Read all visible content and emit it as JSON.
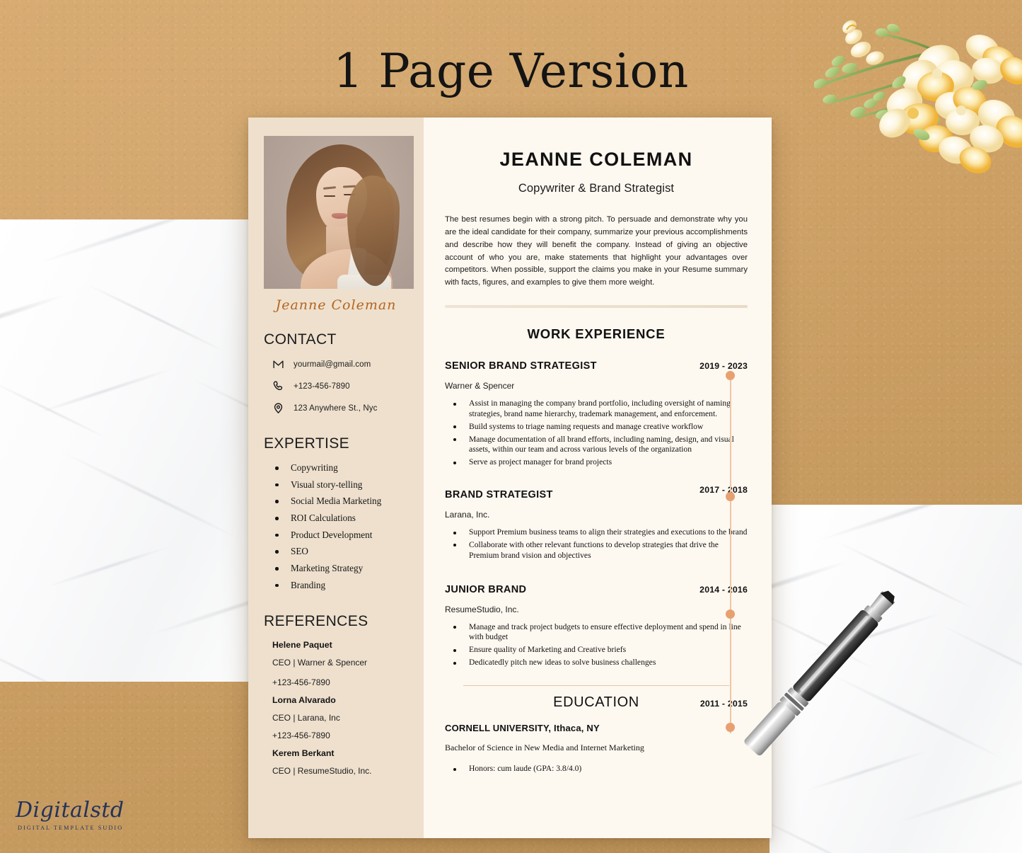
{
  "heading": "1 Page Version",
  "resume": {
    "sidebar": {
      "signature": "Jeanne Coleman",
      "contact": {
        "heading": "CONTACT",
        "items": [
          {
            "icon": "email-icon",
            "text": "yourmail@gmail.com"
          },
          {
            "icon": "phone-icon",
            "text": "+123-456-7890"
          },
          {
            "icon": "location-pin-icon",
            "text": "123 Anywhere St., Nyc"
          }
        ]
      },
      "expertise": {
        "heading": "EXPERTISE",
        "items": [
          "Copywriting",
          "Visual story-telling",
          "Social Media Marketing",
          "ROI Calculations",
          "Product Development",
          "SEO",
          "Marketing Strategy",
          "Branding"
        ]
      },
      "references": {
        "heading": "REFERENCES",
        "items": [
          {
            "name": "Helene Paquet",
            "role": "CEO | Warner & Spencer",
            "phone": "+123-456-7890"
          },
          {
            "name": "Lorna Alvarado",
            "role": "CEO | Larana, Inc",
            "phone": "+123-456-7890"
          },
          {
            "name": "Kerem Berkant",
            "role": "CEO | ResumeStudio, Inc.",
            "phone": ""
          }
        ]
      }
    },
    "main": {
      "name": "JEANNE COLEMAN",
      "title": "Copywriter & Brand Strategist",
      "summary": "The best resumes begin with a strong pitch. To persuade and demonstrate why you are the ideal candidate for their company, summarize your previous accomplishments and describe how they will benefit the company. Instead of giving an objective account of who you are, make statements that highlight your advantages over competitors. When possible, support the claims you make in your Resume summary with facts, figures, and examples to give them more weight.",
      "work_heading": "WORK EXPERIENCE",
      "jobs": [
        {
          "title": "SENIOR BRAND STRATEGIST",
          "date": "2019 - 2023",
          "company": "Warner & Spencer",
          "bullets": [
            "Assist in managing the company brand portfolio, including oversight of naming strategies, brand name hierarchy, trademark management, and enforcement.",
            "Build systems to triage naming requests and manage creative workflow",
            "Manage documentation of all brand efforts, including naming, design, and visual assets, within our team and across various levels of the organization",
            "Serve as project manager for brand projects"
          ]
        },
        {
          "title": "BRAND STRATEGIST",
          "date": "2017 - 2018",
          "company": "Larana, Inc.",
          "bullets": [
            "Support Premium business teams to align their strategies and executions to the brand",
            "Collaborate with other relevant functions to develop strategies that drive the Premium brand vision and objectives"
          ]
        },
        {
          "title": "JUNIOR BRAND",
          "date": "2014 - 2016",
          "company": "ResumeStudio, Inc.",
          "bullets": [
            "Manage and track project budgets to ensure effective deployment and spend in line with budget",
            "Ensure quality of Marketing and Creative briefs",
            "Dedicatedly pitch new ideas to solve business challenges"
          ]
        }
      ],
      "education": {
        "heading": "EDUCATION",
        "date": "2011 - 2015",
        "school": "CORNELL UNIVERSITY, Ithaca, NY",
        "degree": "Bachelor of Science in New Media and Internet Marketing",
        "bullets": [
          "Honors: cum laude (GPA: 3.8/4.0)"
        ]
      }
    }
  },
  "logo": {
    "script": "Digitalstd",
    "subtitle": "DIGITAL TEMPLATE SUDIO"
  },
  "colors": {
    "backdrop": "#cfa267",
    "sidebar": "#eee0cd",
    "page": "#fdf8f0",
    "signature": "#b5651f",
    "timeline_dot": "#e8a070",
    "timeline_line": "#eec7a6",
    "logo": "#22335c"
  }
}
